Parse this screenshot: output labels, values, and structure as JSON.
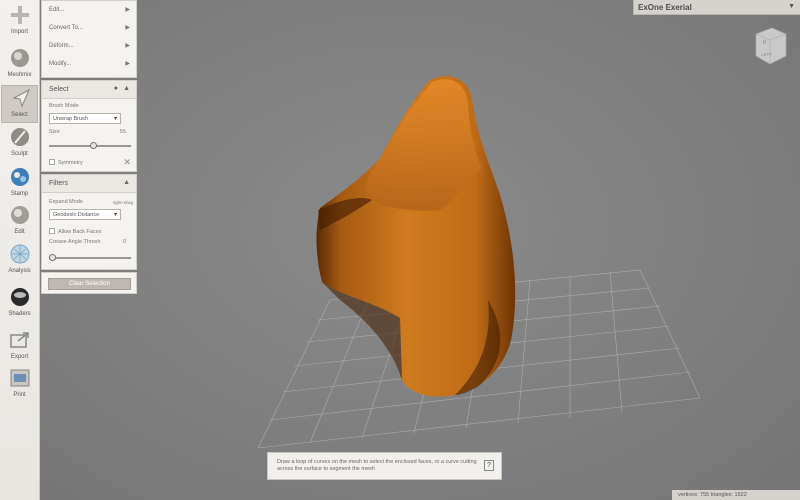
{
  "toolbar": {
    "items": [
      {
        "label": "Import",
        "icon": "plus-icon"
      },
      {
        "label": "Meshmix",
        "icon": "meshmix-icon"
      },
      {
        "label": "Select",
        "icon": "select-arrow-icon"
      },
      {
        "label": "Sculpt",
        "icon": "sculpt-brush-icon"
      },
      {
        "label": "Stamp",
        "icon": "stamp-icon"
      },
      {
        "label": "Edit",
        "icon": "edit-icon"
      },
      {
        "label": "Analysis",
        "icon": "analysis-icon"
      },
      {
        "label": "Shaders",
        "icon": "shaders-icon"
      },
      {
        "label": "Export",
        "icon": "export-icon"
      },
      {
        "label": "Print",
        "icon": "print-icon"
      }
    ],
    "active": "Select"
  },
  "menu": {
    "items": [
      "Edit...",
      "Convert To...",
      "Deform...",
      "Modify..."
    ]
  },
  "select_panel": {
    "title": "Select",
    "brush_mode_label": "Brush Mode",
    "brush_mode_value": "Unwrap Brush",
    "size_label": "Size",
    "size_value": "55",
    "size_fraction": 0.55,
    "symmetry_label": "Symmetry"
  },
  "filters_panel": {
    "title": "Filters",
    "expand_mode_label": "Expand Mode",
    "expand_mode_hint": "right+drag",
    "expand_mode_value": "Geodesic Distance",
    "allow_back_faces_label": "Allow Back Faces",
    "crease_label": "Crease Angle Thresh",
    "crease_value": "0",
    "crease_fraction": 0.0
  },
  "clear_selection_label": "Clear Selection",
  "title": "ExOne Exerial",
  "view_cube_label": "LEFT",
  "hint": {
    "text": "Draw a loop of curves on the mesh to select the enclosed faces, or a curve cutting across the surface to segment the mesh",
    "help": "?"
  },
  "status": "vertices: 755  triangles: 1522",
  "colors": {
    "mesh": "#c8741a",
    "mesh_dark": "#7a3d08",
    "grid": "#b4b4b4",
    "background": "#808080"
  }
}
